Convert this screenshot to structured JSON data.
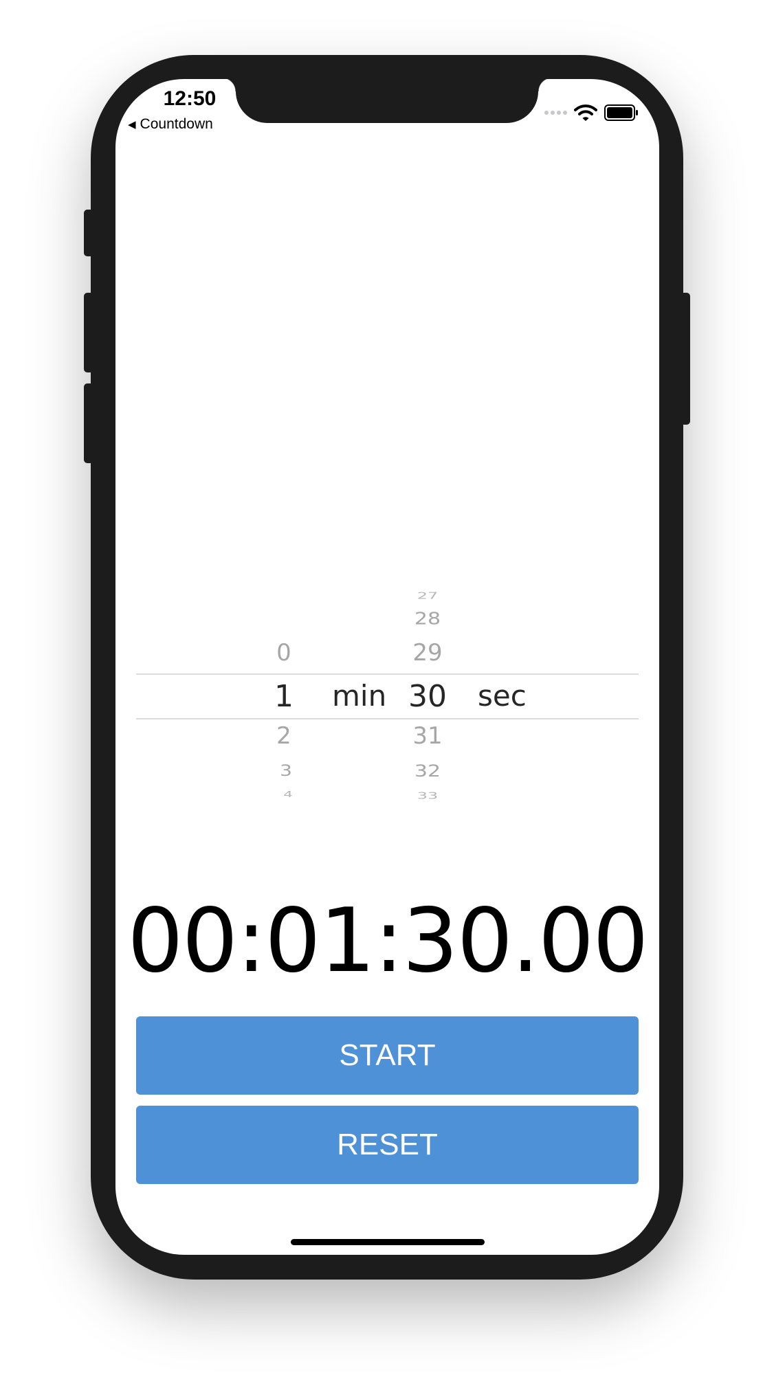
{
  "status_bar": {
    "time": "12:50",
    "back_label": "Countdown"
  },
  "picker": {
    "minutes": {
      "selected": "1",
      "above": [
        "0"
      ],
      "below": [
        "2",
        "3",
        "4"
      ],
      "unit": "min"
    },
    "seconds": {
      "selected": "30",
      "above": [
        "27",
        "28",
        "29"
      ],
      "below": [
        "31",
        "32",
        "33"
      ],
      "unit": "sec"
    }
  },
  "timer_display": "00:01:30.00",
  "buttons": {
    "start": "START",
    "reset": "RESET"
  },
  "colors": {
    "accent": "#4f91d6",
    "frame": "#1c1c1c"
  }
}
